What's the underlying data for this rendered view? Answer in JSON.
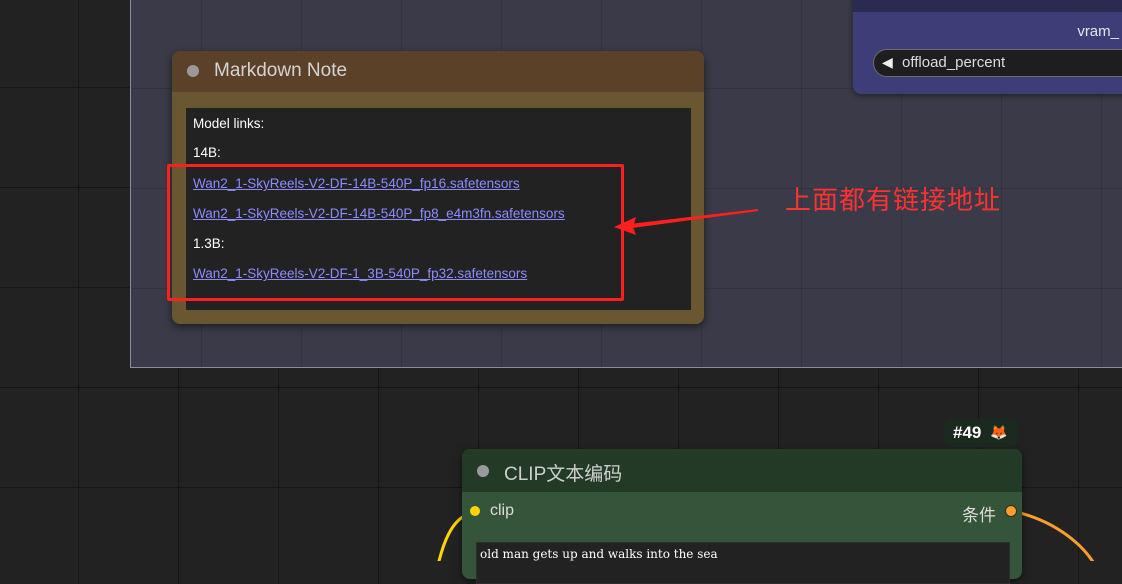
{
  "canvas": {
    "colors": {
      "background": "#222222",
      "group_fill": "#3a3a48",
      "group_border": "#8c8ca4"
    }
  },
  "vram_node": {
    "label": "vram_",
    "widget_label": "offload_percent",
    "arrow_icon": "left-triangle-icon",
    "colors": {
      "body": "#3d3d77"
    }
  },
  "markdown_note": {
    "title": "Markdown Note",
    "lines": [
      {
        "kind": "text",
        "text": "Model links:"
      },
      {
        "kind": "text",
        "text": "14B:"
      },
      {
        "kind": "link",
        "text": "Wan2_1-SkyReels-V2-DF-14B-540P_fp16.safetensors"
      },
      {
        "kind": "link",
        "text": "Wan2_1-SkyReels-V2-DF-14B-540P_fp8_e4m3fn.safetensors"
      },
      {
        "kind": "text",
        "text": "1.3B:"
      },
      {
        "kind": "link",
        "text": "Wan2_1-SkyReels-V2-DF-1_3B-540P_fp32.safetensors"
      }
    ],
    "colors": {
      "header": "#5a4127",
      "body": "#6b5632",
      "link": "#8c8cff"
    }
  },
  "annotation": {
    "text": "上面都有链接地址",
    "colors": {
      "red": "#ff1f1f"
    }
  },
  "badge": {
    "id": "#49",
    "icon": "fox-icon"
  },
  "clip_node": {
    "title": "CLIP文本编码",
    "input_label": "clip",
    "output_label": "条件",
    "prompt": "old man gets up and walks into the sea",
    "colors": {
      "header": "#233a26",
      "body": "#34553a",
      "input_slot": "#ffd500",
      "output_slot": "#ff9d2e"
    }
  }
}
